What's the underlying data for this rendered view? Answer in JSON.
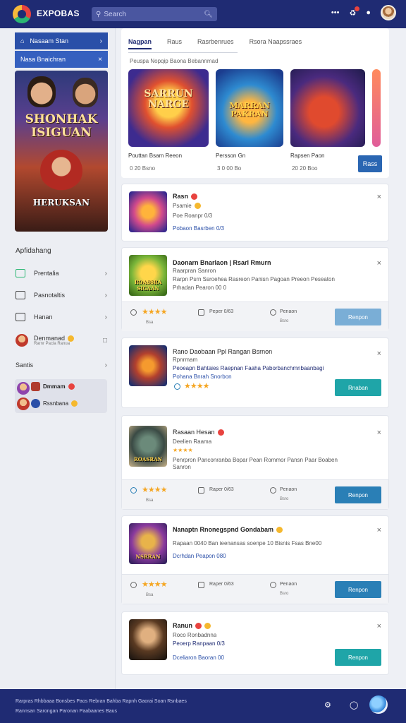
{
  "header": {
    "brand": "EXPOBAS",
    "search_placeholder": "Search",
    "icons": [
      "search-icon",
      "dots-icon",
      "bell-icon",
      "chat-icon"
    ]
  },
  "sidebar": {
    "button1": "Nasaam Stan",
    "button2": "Nasa Bnaichran",
    "poster_title": "SHONHAK ISIGUAN",
    "poster_subtitle": "HERUKSAN",
    "section_title": "Apfidahang",
    "items": [
      {
        "label": "Prentalia",
        "icon": "calendar-icon"
      },
      {
        "label": "Pasnotaltis",
        "icon": "doc-icon"
      },
      {
        "label": "Hanan",
        "icon": "folder-icon"
      },
      {
        "label": "Denmanad",
        "sub": "Rarnr Pacla Ranua",
        "icon": "avatar-icon"
      }
    ],
    "section2": "Santis",
    "featured_name": "Dmmam",
    "featured_sub": "Rssnbana"
  },
  "tabs": {
    "items": [
      "Nagpan",
      "Raus",
      "Rasrbenrues",
      "Rsora Naapssraes"
    ],
    "subtitle": "Peuspa Nopqip  Baona Bebannmad",
    "tiles": [
      {
        "title": "SARRUN NARGE",
        "caption": "Pouttan Bsam Reeon",
        "meta": "0  20  Bsno"
      },
      {
        "title": "MARRAN PAKRAN",
        "caption": "Persson Gn",
        "meta": "3 0  00  Bo"
      },
      {
        "title": "",
        "caption": "Rapsen Paon",
        "meta": "20  20  Boo"
      }
    ],
    "button": "Rass"
  },
  "cards": [
    {
      "title": "Rasn",
      "sub": "Psamie",
      "line": "Poe Roanpr 0/3",
      "link": "Pobaon Basrben  0/3",
      "thumb": "",
      "has_footer": false
    },
    {
      "title": "Daonarn Bnarlaon | Rsarl Rmurn",
      "sub": "Raarpran Sanron",
      "line": "Rarpn Psrn Ssroehea Rasreon Panisn Pagoan Preeon Peseaton",
      "link": "Prhadan Pearon 00 0",
      "thumb": "ROASSRA SIGAAN",
      "has_footer": true,
      "footer": {
        "rating": "★★★★",
        "rating_sub": "Bsa",
        "mid": "Peper 0/63",
        "right": "Penaon",
        "right_sub": "Bsro",
        "button": "Renpon"
      }
    },
    {
      "title": "Rano Daobaan Ppl Rangan Bsrnon",
      "sub": "Rpnrmam",
      "line": "Peoeapn Bahtaies Raepnan Faaha Paborbanchmnbaanbagi",
      "link": "Pohana Bnrah Snorbon",
      "thumb": "",
      "has_footer": false,
      "button": "Rnaban",
      "stars": "★★★★"
    },
    {
      "title": "Rasaan Hesan",
      "sub": "Deelien Raama",
      "line": "Penrpron Panconranba Bopar Pean Rommor Pansn Paar Boaben",
      "link": "Sanron",
      "thumb": "ROASRAN",
      "has_footer": true,
      "footer": {
        "rating": "★★★★",
        "rating_sub": "Bsa",
        "mid": "Raper 0/63",
        "right": "Penaon",
        "right_sub": "Bsro",
        "button": "Renpon"
      }
    },
    {
      "title": "Nanaptn Rnonegspnd Gondabam",
      "sub": "",
      "line": "Rapaan 0040 Ban ieenansas soenpe 10 Bisnis Fsas Bne00",
      "link": "Dcrhdan Peapon 080",
      "thumb": "NSRRAN",
      "has_footer": true,
      "footer": {
        "rating": "★★★★",
        "rating_sub": "Bsa",
        "mid": "Raper 0/63",
        "right": "Penaon",
        "right_sub": "Bsro",
        "button": "Renpon"
      }
    },
    {
      "title": "Ranun",
      "sub": "Roco Ronbadnna",
      "line": "Peoerp Ranpaan 0/3",
      "link": "Dceliaron Baoran  00",
      "thumb": "",
      "has_footer": false,
      "button": "Renpon"
    }
  ],
  "footer": {
    "line1": "Rarpras Rhbbaaa Bonsbes Paos Rebran Bahba Rapnh Gaorai Soan Rsnbaes",
    "line2": "Rannsan Sarongan Paronan Paabaanes Baus"
  },
  "colors": {
    "brand": "#1f2b73",
    "accent": "#2a4fa8",
    "teal": "#1fa5a8",
    "star": "#f5a623"
  }
}
